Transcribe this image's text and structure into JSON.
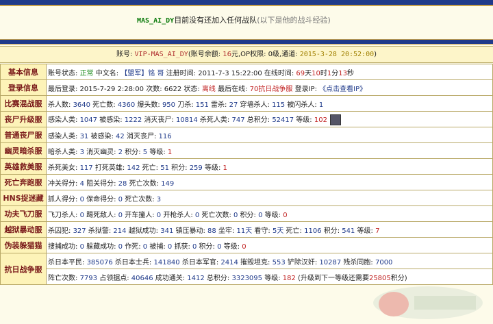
{
  "banner": {
    "player": "MAS_AI_DY",
    "no_team": "目前没有还加入任何战队",
    "note": "(以下是他的战斗经验)"
  },
  "account": {
    "acct_label": "账号: ",
    "acct_id": "VIP-MAS_AI_DY",
    "balance_label": "(账号余额: ",
    "balance": "16",
    "balance_unit": "元,OP权限: ",
    "op": "0级",
    "channel_label": ",通道: ",
    "date": "2015-3-28 20:52:00",
    "close": ")"
  },
  "rows": [
    {
      "label": "基本信息",
      "content": [
        {
          "t": "账号状态: "
        },
        {
          "t": "正常",
          "c": "g"
        },
        {
          "t": " 中文名: "
        },
        {
          "t": "【盟军】铭 哥",
          "c": "n"
        },
        {
          "t": " 注册时间: 2011-7-3 15:22:00 在线时间: "
        },
        {
          "t": "69",
          "c": "r"
        },
        {
          "t": "天"
        },
        {
          "t": "10",
          "c": "r"
        },
        {
          "t": "时"
        },
        {
          "t": "1",
          "c": "r"
        },
        {
          "t": "分"
        },
        {
          "t": "13",
          "c": "r"
        },
        {
          "t": "秒"
        }
      ]
    },
    {
      "label": "登录信息",
      "content": [
        {
          "t": "最后登录: 2015-7-29 2:28:00 次数: 6622 状态: "
        },
        {
          "t": "离线",
          "c": "r"
        },
        {
          "t": " 最后在线: "
        },
        {
          "t": "70抗日战争服",
          "c": "r"
        },
        {
          "t": " 登录IP: "
        },
        {
          "t": "《点击查看IP》",
          "c": "lnk"
        }
      ]
    },
    {
      "label": "比赛混战服",
      "content": [
        {
          "t": "杀人数: "
        },
        {
          "t": "3640",
          "c": "n"
        },
        {
          "t": " 死亡数: "
        },
        {
          "t": "4360",
          "c": "n"
        },
        {
          "t": " 爆头数: "
        },
        {
          "t": "950",
          "c": "n"
        },
        {
          "t": " 刀杀: "
        },
        {
          "t": "151",
          "c": "n"
        },
        {
          "t": " 雷杀: "
        },
        {
          "t": "27",
          "c": "n"
        },
        {
          "t": " 穿墙杀人: "
        },
        {
          "t": "115",
          "c": "n"
        },
        {
          "t": " 被闪杀人: "
        },
        {
          "t": "1",
          "c": "n"
        }
      ]
    },
    {
      "label": "丧尸升级服",
      "content": [
        {
          "t": "感染人类: "
        },
        {
          "t": "1047",
          "c": "n"
        },
        {
          "t": " 被感染: "
        },
        {
          "t": "1222",
          "c": "n"
        },
        {
          "t": " 消灭丧尸: "
        },
        {
          "t": "10814",
          "c": "n"
        },
        {
          "t": " 杀死人类: "
        },
        {
          "t": "747",
          "c": "n"
        },
        {
          "t": " 总积分: "
        },
        {
          "t": "52417",
          "c": "n"
        },
        {
          "t": " 等级: "
        },
        {
          "t": "102",
          "c": "r"
        }
      ],
      "avatar": true
    },
    {
      "label": "普通丧尸服",
      "content": [
        {
          "t": "感染人类: "
        },
        {
          "t": "31",
          "c": "n"
        },
        {
          "t": " 被感染: "
        },
        {
          "t": "42",
          "c": "n"
        },
        {
          "t": " 消灭丧尸: "
        },
        {
          "t": "116",
          "c": "n"
        }
      ]
    },
    {
      "label": "幽灵暗杀服",
      "content": [
        {
          "t": "暗杀人类: "
        },
        {
          "t": "3",
          "c": "n"
        },
        {
          "t": " 消灭幽灵: "
        },
        {
          "t": "2",
          "c": "n"
        },
        {
          "t": " 积分: "
        },
        {
          "t": "5",
          "c": "n"
        },
        {
          "t": " 等级: "
        },
        {
          "t": "1",
          "c": "r"
        }
      ]
    },
    {
      "label": "英雄救美服",
      "content": [
        {
          "t": "杀死美女: "
        },
        {
          "t": "117",
          "c": "n"
        },
        {
          "t": " 打死英雄: "
        },
        {
          "t": "142",
          "c": "n"
        },
        {
          "t": " 死亡: "
        },
        {
          "t": "51",
          "c": "n"
        },
        {
          "t": " 积分: "
        },
        {
          "t": "259",
          "c": "n"
        },
        {
          "t": " 等级: "
        },
        {
          "t": "1",
          "c": "r"
        }
      ]
    },
    {
      "label": "死亡奔跑服",
      "content": [
        {
          "t": "冲关得分: "
        },
        {
          "t": "4",
          "c": "n"
        },
        {
          "t": " 阻关得分: "
        },
        {
          "t": "28",
          "c": "n"
        },
        {
          "t": " 死亡次数: "
        },
        {
          "t": "149",
          "c": "n"
        }
      ]
    },
    {
      "label": "HNS捉迷藏",
      "content": [
        {
          "t": "抓人得分: "
        },
        {
          "t": "0",
          "c": "n"
        },
        {
          "t": " 保命得分: "
        },
        {
          "t": "0",
          "c": "n"
        },
        {
          "t": " 死亡次数: "
        },
        {
          "t": "3",
          "c": "n"
        }
      ]
    },
    {
      "label": "功夫飞刀服",
      "content": [
        {
          "t": "飞刀杀人: "
        },
        {
          "t": "0",
          "c": "n"
        },
        {
          "t": " 踢死敌人: "
        },
        {
          "t": "0",
          "c": "n"
        },
        {
          "t": " 开车撞人: "
        },
        {
          "t": "0",
          "c": "n"
        },
        {
          "t": " 开枪杀人: "
        },
        {
          "t": "0",
          "c": "n"
        },
        {
          "t": " 死亡次数: "
        },
        {
          "t": "0",
          "c": "n"
        },
        {
          "t": " 积分: "
        },
        {
          "t": "0",
          "c": "n"
        },
        {
          "t": " 等级: "
        },
        {
          "t": "0",
          "c": "r"
        }
      ]
    },
    {
      "label": "越狱暴动服",
      "content": [
        {
          "t": "杀囚犯: "
        },
        {
          "t": "327",
          "c": "n"
        },
        {
          "t": " 杀狱警: "
        },
        {
          "t": "214",
          "c": "n"
        },
        {
          "t": " 越狱成功: "
        },
        {
          "t": "341",
          "c": "n"
        },
        {
          "t": " 镇压暴动: "
        },
        {
          "t": "88",
          "c": "n"
        },
        {
          "t": " 坐牢: "
        },
        {
          "t": "11天",
          "c": "n"
        },
        {
          "t": " 看守: "
        },
        {
          "t": "5天",
          "c": "n"
        },
        {
          "t": " 死亡: "
        },
        {
          "t": "1106",
          "c": "n"
        },
        {
          "t": " 积分: "
        },
        {
          "t": "541",
          "c": "n"
        },
        {
          "t": " 等级: "
        },
        {
          "t": "7",
          "c": "r"
        }
      ]
    },
    {
      "label": "伪装躲猫猫",
      "content": [
        {
          "t": "搜捕成功: "
        },
        {
          "t": "0",
          "c": "n"
        },
        {
          "t": " 躲藏成功: "
        },
        {
          "t": "0",
          "c": "n"
        },
        {
          "t": " 作死: "
        },
        {
          "t": "0",
          "c": "n"
        },
        {
          "t": " 被捕: "
        },
        {
          "t": "0",
          "c": "n"
        },
        {
          "t": " 抓获: "
        },
        {
          "t": "0",
          "c": "n"
        },
        {
          "t": " 积分: "
        },
        {
          "t": "0",
          "c": "n"
        },
        {
          "t": " 等级: "
        },
        {
          "t": "0",
          "c": "r"
        }
      ]
    }
  ],
  "war": {
    "label": "抗日战争服",
    "line1": [
      {
        "t": "杀日本平民: "
      },
      {
        "t": "385076",
        "c": "n"
      },
      {
        "t": " 杀日本士兵: "
      },
      {
        "t": "141840",
        "c": "n"
      },
      {
        "t": " 杀日本军官: "
      },
      {
        "t": "2414",
        "c": "n"
      },
      {
        "t": " 摧毁坦克: "
      },
      {
        "t": "553",
        "c": "n"
      },
      {
        "t": " 铲除汉奸: "
      },
      {
        "t": "10287",
        "c": "n"
      },
      {
        "t": " 残杀同胞: "
      },
      {
        "t": "7000",
        "c": "n"
      }
    ],
    "line2": [
      {
        "t": "阵亡次数: "
      },
      {
        "t": "7793",
        "c": "n"
      },
      {
        "t": " 占领据点: "
      },
      {
        "t": "40646",
        "c": "n"
      },
      {
        "t": " 成功通关: "
      },
      {
        "t": "1412",
        "c": "n"
      },
      {
        "t": " 总积分: "
      },
      {
        "t": "3323095",
        "c": "n"
      },
      {
        "t": " 等级: "
      },
      {
        "t": "182",
        "c": "r"
      },
      {
        "t": " (升级到下一等级还需要"
      },
      {
        "t": "25805",
        "c": "r"
      },
      {
        "t": "积分)"
      }
    ]
  },
  "colors": {
    "accent": "#1f3a8a",
    "label": "#7a1a1a",
    "number": "#1f3a8a",
    "red": "#c02020",
    "green": "#1a8a1a"
  }
}
